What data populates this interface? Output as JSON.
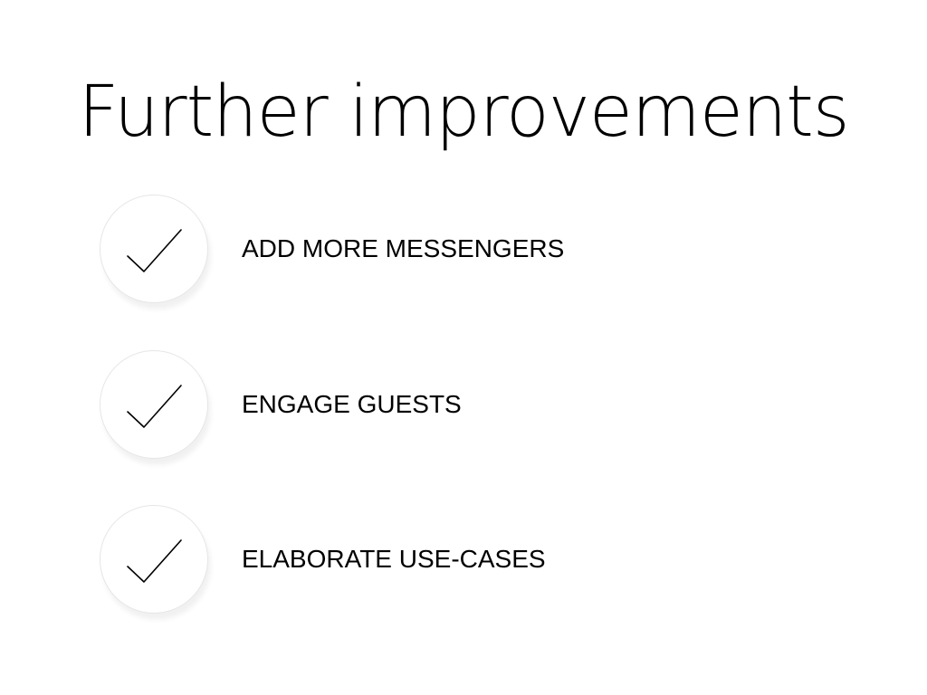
{
  "slide": {
    "title": "Further improvements",
    "items": [
      {
        "label": "ADD MORE MESSENGERS",
        "icon": "checkmark-icon"
      },
      {
        "label": "ENGAGE GUESTS",
        "icon": "checkmark-icon"
      },
      {
        "label": "ELABORATE USE-CASES",
        "icon": "checkmark-icon"
      }
    ]
  }
}
